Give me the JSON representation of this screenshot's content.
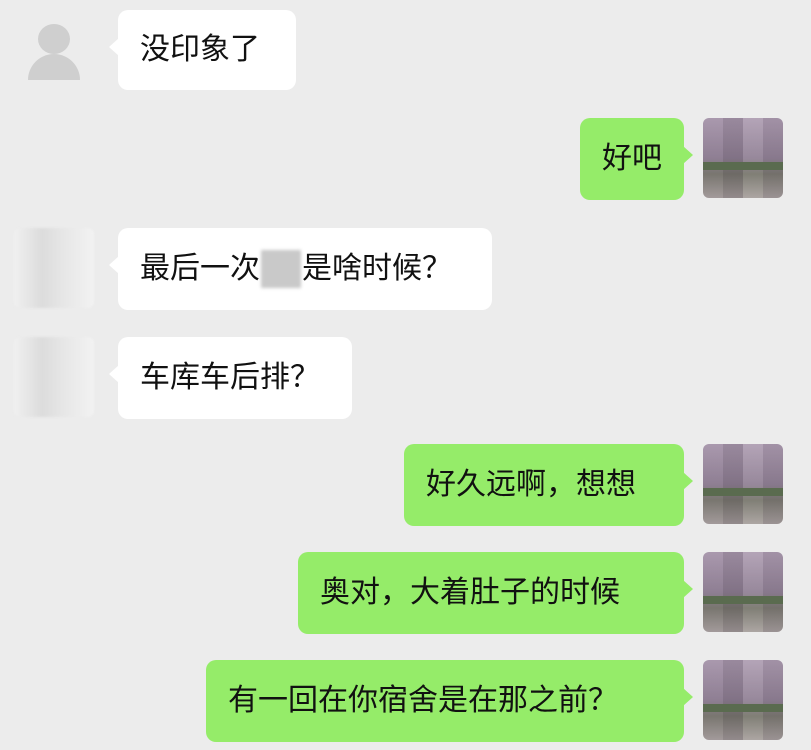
{
  "conversation": {
    "messages": [
      {
        "side": "left",
        "avatar": "default-avatar-icon",
        "text": "没印象了"
      },
      {
        "side": "right",
        "avatar": "pixelated-avatar",
        "text": "好吧"
      },
      {
        "side": "left",
        "avatar": "blurred-avatar",
        "text_before": "最后一次",
        "text_after": "是啥时候？",
        "censored": true
      },
      {
        "side": "left",
        "avatar": "blurred-avatar",
        "text": "车库车后排？"
      },
      {
        "side": "right",
        "avatar": "pixelated-avatar",
        "text": "好久远啊，想想"
      },
      {
        "side": "right",
        "avatar": "pixelated-avatar",
        "text": "奥对，大着肚子的时候"
      },
      {
        "side": "right",
        "avatar": "pixelated-avatar",
        "text": "有一回在你宿舍是在那之前？"
      }
    ]
  },
  "colors": {
    "background": "#ececec",
    "incoming_bubble": "#ffffff",
    "outgoing_bubble": "#95ec69"
  }
}
